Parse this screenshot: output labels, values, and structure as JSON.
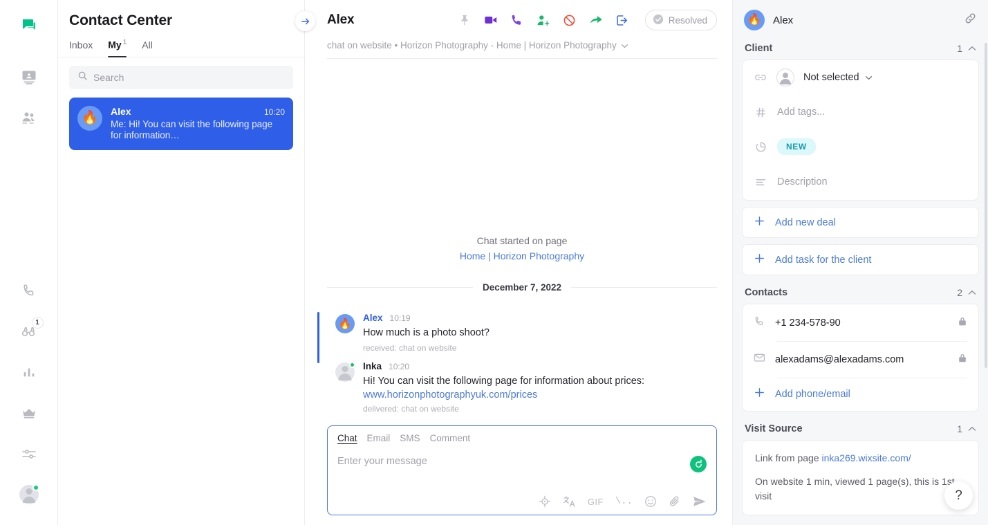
{
  "rail": {
    "items": [
      {
        "name": "chats-icon",
        "active": true
      },
      {
        "name": "contacts-card-icon",
        "active": false
      },
      {
        "name": "team-icon",
        "active": false
      },
      {
        "name": "phone-icon",
        "active": false
      },
      {
        "name": "binoculars-icon",
        "active": false,
        "badge": "1"
      },
      {
        "name": "analytics-icon",
        "active": false
      },
      {
        "name": "crown-icon",
        "active": false
      },
      {
        "name": "settings-sliders-icon",
        "active": false
      },
      {
        "name": "user-avatar-icon",
        "active": false
      }
    ],
    "binoculars_badge": "1"
  },
  "list": {
    "title": "Contact Center",
    "tabs": [
      {
        "label": "Inbox",
        "sup": "",
        "active": false
      },
      {
        "label": "My",
        "sup": "1",
        "active": true
      },
      {
        "label": "All",
        "sup": "",
        "active": false
      }
    ],
    "search": {
      "placeholder": "Search",
      "value": ""
    },
    "conversation": {
      "avatar": "🔥",
      "name": "Alex",
      "time": "10:20",
      "preview": "Me: Hi! You can visit the following page for information…"
    }
  },
  "chat": {
    "collapse_icon": "→",
    "title": "Alex",
    "actions": [
      {
        "name": "pin-icon",
        "label": "Pin"
      },
      {
        "name": "video-call-icon",
        "label": "Video call"
      },
      {
        "name": "phone-call-icon",
        "label": "Call"
      },
      {
        "name": "add-participant-icon",
        "label": "Add participant"
      },
      {
        "name": "ban-icon",
        "label": "Block"
      },
      {
        "name": "forward-icon",
        "label": "Forward"
      },
      {
        "name": "transfer-icon",
        "label": "Transfer"
      }
    ],
    "resolved_label": "Resolved",
    "subtitle": "chat on website • Horizon Photography - Home | Horizon Photography",
    "started": {
      "label": "Chat started on page",
      "page": "Home | Horizon Photography"
    },
    "date_separator": "December 7, 2022",
    "messages": [
      {
        "author": "Alex",
        "author_type": "client",
        "avatar": "🔥",
        "time": "10:19",
        "text": "How much is a photo shoot?",
        "link": "",
        "meta": "received: chat on website",
        "unread": true,
        "online": false
      },
      {
        "author": "Inka",
        "author_type": "agent",
        "avatar": "",
        "time": "10:20",
        "text": "Hi! You can visit the following page for information about prices:",
        "link": "www.horizonphotographyuk.com/prices",
        "meta": "delivered: chat on website",
        "unread": false,
        "online": true
      }
    ]
  },
  "composer": {
    "tabs": [
      {
        "label": "Chat",
        "active": true
      },
      {
        "label": "Email",
        "active": false
      },
      {
        "label": "SMS",
        "active": false
      },
      {
        "label": "Comment",
        "active": false
      }
    ],
    "placeholder": "Enter your message",
    "value": "",
    "ai_button": "ai-assist-button",
    "tools": [
      {
        "name": "target-icon",
        "label": ""
      },
      {
        "name": "translate-icon",
        "label": ""
      },
      {
        "name": "gif-icon",
        "label": "GIF"
      },
      {
        "name": "slash-command-icon",
        "label": "\\.."
      },
      {
        "name": "emoji-icon",
        "label": ""
      },
      {
        "name": "attachment-icon",
        "label": ""
      },
      {
        "name": "send-icon",
        "label": ""
      }
    ]
  },
  "right": {
    "header": {
      "avatar": "🔥",
      "name": "Alex",
      "link_icon": "link-icon"
    },
    "client": {
      "title": "Client",
      "count": "1",
      "selector": "Not selected",
      "tags_placeholder": "Add tags...",
      "stage_badge": "NEW",
      "description_placeholder": "Description"
    },
    "actions": [
      {
        "label": "Add new deal",
        "name": "add-new-deal-button"
      },
      {
        "label": "Add task for the client",
        "name": "add-task-button"
      }
    ],
    "contacts": {
      "title": "Contacts",
      "count": "2",
      "rows": [
        {
          "icon": "phone-icon",
          "value": "+1 234-578-90",
          "locked": true
        },
        {
          "icon": "email-icon",
          "value": "alexadams@alexadams.com",
          "locked": true
        }
      ],
      "add_label": "Add phone/email"
    },
    "visit_source": {
      "title": "Visit Source",
      "count": "1",
      "line1_prefix": "Link from page ",
      "line1_link": "inka269.wixsite.com/",
      "line2": "On website 1 min, viewed 1 page(s), this is 1st visit"
    },
    "help_label": "?"
  },
  "colors": {
    "accent_blue": "#2f5ee8",
    "link_blue": "#4b7bd8",
    "brand_green": "#0ec27e",
    "badge_cyan_bg": "#dbf8fb",
    "badge_cyan_fg": "#1b9aad",
    "panel_bg": "#f6f7f9"
  }
}
